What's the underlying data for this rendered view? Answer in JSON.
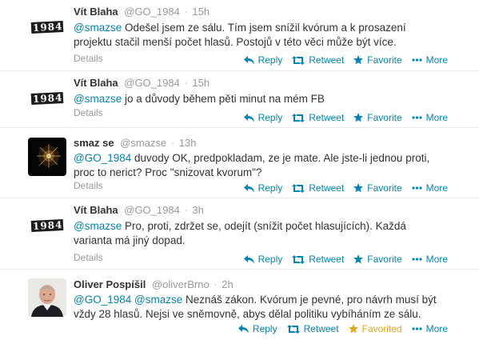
{
  "tweets": [
    {
      "fullname": "Vít Blaha",
      "username": "@GO_1984",
      "time": "15h",
      "mention": "@smazse",
      "text": " Odešel jsem ze sálu. Tím jsem snížil kvórum a k prosazení projektu stačil menší počet hlasů. Postojů v této věci může být více.",
      "avatar": "1984-icon",
      "favorited": false
    },
    {
      "fullname": "Vít Blaha",
      "username": "@GO_1984",
      "time": "15h",
      "mention": "@smazse",
      "text": " jo a důvody během pěti minut na mém FB",
      "avatar": "1984-icon",
      "favorited": false
    },
    {
      "fullname": "smaz se",
      "username": "@smazse",
      "time": "13h",
      "mention": "@GO_1984",
      "text": " duvody OK, predpokladam, ze je mate. Ale jste-li jednou proti, proc to nerict? Proc \"snizovat kvorum\"?",
      "avatar": "firework-icon",
      "favorited": false
    },
    {
      "fullname": "Vít Blaha",
      "username": "@GO_1984",
      "time": "3h",
      "mention": "@smazse",
      "text": " Pro, proti, zdržet se, odejít (snížit počet hlasujících). Každá varianta má jiný dopad.",
      "avatar": "1984-icon",
      "favorited": false
    },
    {
      "fullname": "Oliver Pospíšil",
      "username": "@oliverBrno",
      "time": "2h",
      "mention": "@GO_1984 @smazse",
      "text": " Neznáš zákon. Kvórum je pevné, pro návrh musí být vždy 28 hlasů. Nejsi ve sněmovně, abys dělal politiku vybíháním ze sálu.",
      "avatar": "person-photo-icon",
      "favorited": true
    }
  ],
  "labels": {
    "details": "Details",
    "reply": "Reply",
    "retweet": "Retweet",
    "favorite": "Favorite",
    "favorited": "Favorited",
    "more": "More",
    "avatar_text": "1984"
  },
  "colors": {
    "link": "#0084b4",
    "favorited": "#e2a51b",
    "muted": "#999999"
  }
}
